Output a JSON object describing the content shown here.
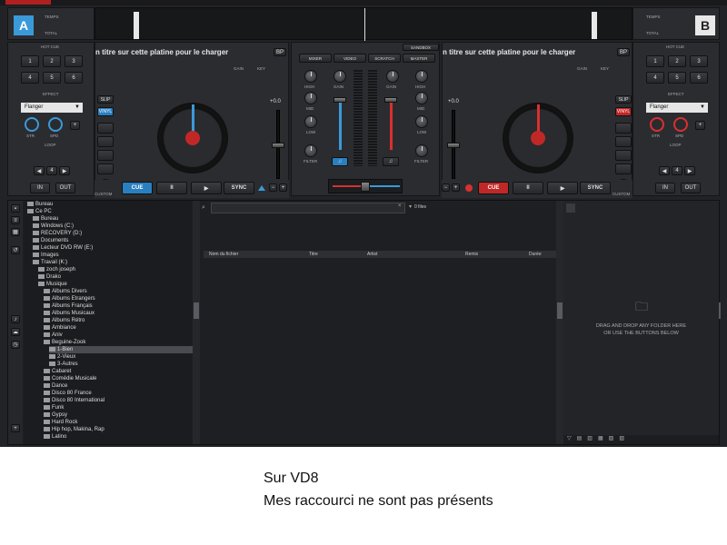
{
  "deck_a": {
    "letter": "A",
    "top_label1": "TEMPS",
    "top_label2": "TOTAL",
    "track_text": "n titre sur cette platine pour le charger",
    "bpm_btn": "BP",
    "gain_label": "GAIN",
    "key_label": "KEY",
    "hotcue_label": "HOT CUE",
    "hotcues": [
      "1",
      "2",
      "3",
      "4",
      "5",
      "6"
    ],
    "effect_label": "EFFECT",
    "effect_value": "Flanger",
    "str_label": "STR",
    "spd_label": "SPD",
    "loop_label": "LOOP",
    "loop_in": "IN",
    "loop_out": "OUT",
    "slip": "SLIP",
    "vinyl": "VINYL",
    "pitch_value": "+0.0",
    "custom": "CUSTOM",
    "cue": "CUE",
    "pause": "II",
    "play": "▶",
    "sync": "SYNC"
  },
  "deck_b": {
    "letter": "B",
    "top_label1": "TEMPS",
    "top_label2": "TOTAL",
    "track_text": "n titre sur cette platine pour le charger",
    "bpm_btn": "BP",
    "gain_label": "GAIN",
    "key_label": "KEY",
    "hotcue_label": "HOT CUE",
    "hotcues": [
      "1",
      "2",
      "3",
      "4",
      "5",
      "6"
    ],
    "effect_label": "EFFECT",
    "effect_value": "Flanger",
    "str_label": "STR",
    "spd_label": "SPD",
    "loop_label": "LOOP",
    "loop_in": "IN",
    "loop_out": "OUT",
    "slip": "SLIP",
    "vinyl": "VINYL",
    "pitch_value": "+0.0",
    "custom": "CUSTOM",
    "cue": "CUE",
    "pause": "II",
    "play": "▶",
    "sync": "SYNC"
  },
  "mixer": {
    "sandbox": "SANDBOX",
    "tabs": [
      "MIXER",
      "VIDEO",
      "SCRATCH",
      "MASTER"
    ],
    "high": "HIGH",
    "mid": "MID",
    "low": "LOW",
    "filter": "FILTER",
    "gain": "GAIN"
  },
  "browser": {
    "files_count": "0 files",
    "columns": [
      "Nom du fichier",
      "Titre",
      "Artist",
      "Remix",
      "Durée"
    ],
    "side_label": "SIDEVIEW",
    "drop_line1": "DRAG AND DROP ANY FOLDER HERE",
    "drop_line2": "OR USE THE BUTTONS BELOW"
  },
  "tree": [
    "Bureau",
    "Ce PC",
    "Bureau",
    "Windows (C:)",
    "RECOVERY (D:)",
    "Documents",
    "Lecteur DVD RW (E:)",
    "Images",
    "Travail (K:)",
    "zoch joseph",
    "Drako",
    "Musique",
    "Albums Divers",
    "Albums Etrangers",
    "Albums Français",
    "Albums Musicaux",
    "Albums Rétro",
    "Ambiance",
    "Aniv",
    "Beguine-Zook",
    "1-Bien",
    "2-Vieux",
    "3-Autres",
    "Cabaret",
    "Comédie Musicale",
    "Dance",
    "Disco 80 France",
    "Disco 80 International",
    "Funk",
    "Gypsy",
    "Hard Rock",
    "Hip hop, Makina, Rap",
    "Latino"
  ],
  "caption": {
    "line1": "Sur VD8",
    "line2": "Mes raccourci ne sont pas présents"
  },
  "colors": {
    "deck_a_accent": "#3a9ad9",
    "deck_b_accent": "#d93030",
    "cue_a": "#2a7fc0",
    "cue_b": "#c02828"
  }
}
